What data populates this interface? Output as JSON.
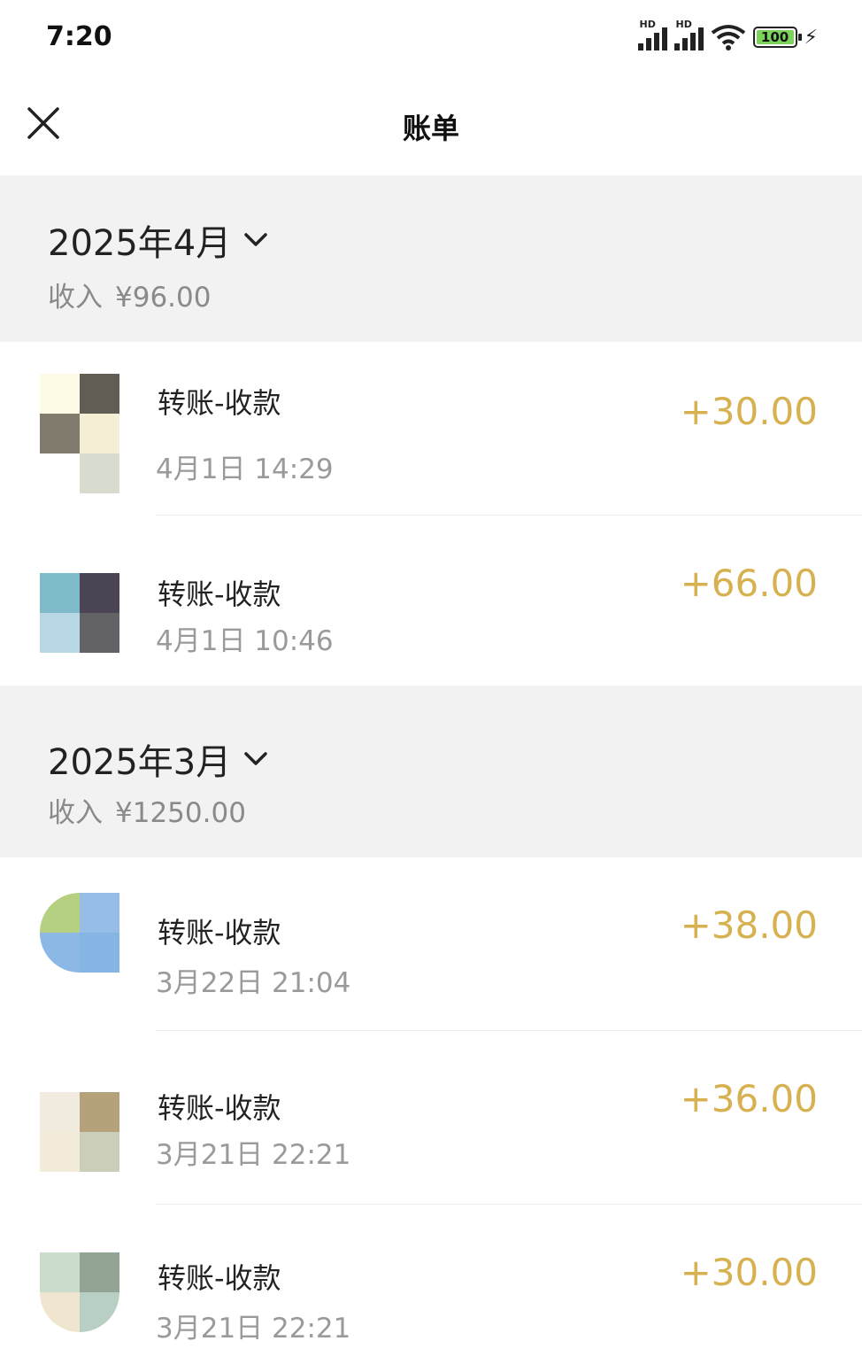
{
  "status_bar": {
    "time": "7:20",
    "battery_level": "100",
    "icons": [
      "signal-hd-icon",
      "signal-hd-icon",
      "wifi-icon",
      "battery-icon",
      "charging-bolt-icon"
    ]
  },
  "nav": {
    "close_icon": "close-icon",
    "title": "账单"
  },
  "months": [
    {
      "label": "2025年4月",
      "summary_label": "收入",
      "summary_amount": "¥96.00",
      "items": [
        {
          "name": "转账-收款",
          "time": "4月1日 14:29",
          "amount": "+30.00",
          "avatar_colors": [
            "#fdfbe6",
            "#615d55",
            "#807b6c",
            "#f4eed5",
            "#ffffff",
            "#d8dcce"
          ]
        },
        {
          "name": "转账-收款",
          "time": "4月1日 10:46",
          "amount": "+66.00",
          "avatar_colors": [
            "#7fbac9",
            "#4b4454",
            "#b9d8e6",
            "#636267"
          ]
        }
      ]
    },
    {
      "label": "2025年3月",
      "summary_label": "收入",
      "summary_amount": "¥1250.00",
      "items": [
        {
          "name": "转账-收款",
          "time": "3月22日 21:04",
          "amount": "+38.00",
          "avatar_colors": [
            "#b6d081",
            "#95bde6",
            "#8cb8e6",
            "#85b5e2"
          ]
        },
        {
          "name": "转账-收款",
          "time": "3月21日 22:21",
          "amount": "+36.00",
          "avatar_colors": [
            "#f2ece0",
            "#b6a27a",
            "#f4ecdb",
            "#cbceb8"
          ]
        },
        {
          "name": "转账-收款",
          "time": "3月21日 22:21",
          "amount": "+30.00",
          "avatar_colors": [
            "#ccdccc",
            "#93a394",
            "#f0e6cf",
            "#b8d0c4"
          ]
        }
      ]
    }
  ]
}
